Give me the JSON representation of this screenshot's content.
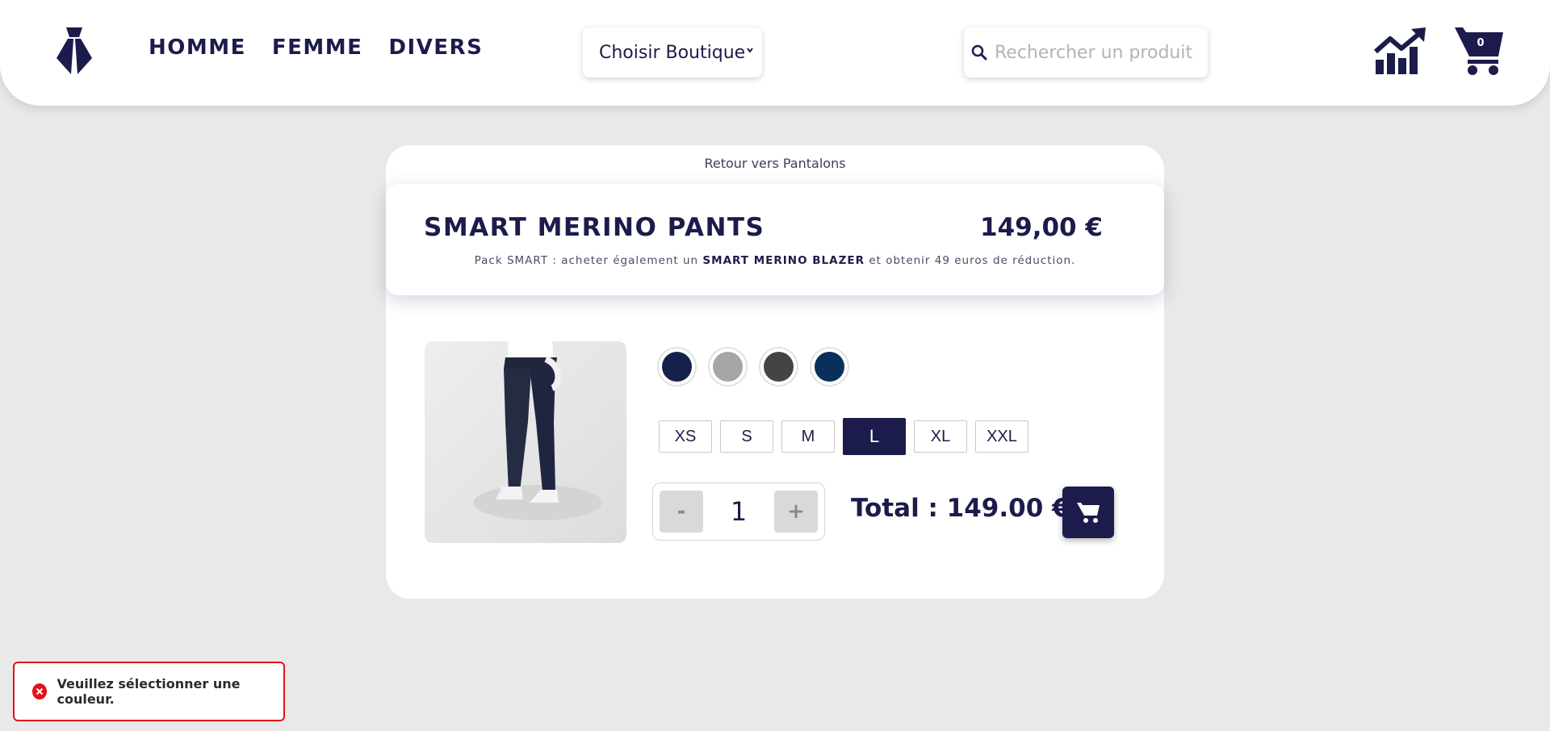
{
  "header": {
    "nav": [
      "HOMME",
      "FEMME",
      "DIVERS"
    ],
    "shop_select": {
      "selected": "Choisir Boutique"
    },
    "search": {
      "placeholder": "Rechercher un produit",
      "value": ""
    },
    "cart_count": "0",
    "icons": [
      "logo-icon",
      "chevron-down-icon",
      "search-icon",
      "stats-icon",
      "cart-icon"
    ]
  },
  "product": {
    "back_link": "Retour vers Pantalons",
    "title": "SMART MERINO PANTS",
    "price": "149,00 €",
    "pack_prefix": "Pack SMART : acheter également un",
    "pack_product": "SMART MERINO BLAZER",
    "pack_suffix": "et obtenir 49 euros de réduction.",
    "colors": [
      "#14224b",
      "#a6a6a6",
      "#444444",
      "#0a2f5a"
    ],
    "sizes": [
      {
        "label": "XS",
        "selected": false
      },
      {
        "label": "S",
        "selected": false
      },
      {
        "label": "M",
        "selected": false
      },
      {
        "label": "L",
        "selected": true
      },
      {
        "label": "XL",
        "selected": false
      },
      {
        "label": "XXL",
        "selected": false
      }
    ],
    "quantity": "1",
    "minus_label": "-",
    "plus_label": "+",
    "total": "Total : 149.00 €"
  },
  "toast": {
    "message": "Veuillez sélectionner une couleur.",
    "color": "#e0141a"
  },
  "theme": {
    "primary": "#1b1c4b",
    "background": "#e9e9e9"
  }
}
